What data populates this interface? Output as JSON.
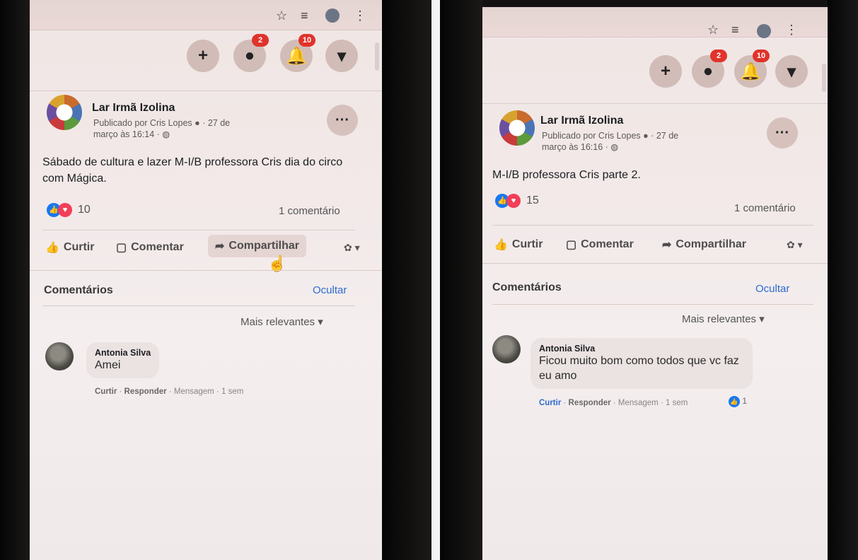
{
  "screenshots": [
    {
      "browser": {
        "star_icon": "star-icon",
        "queue_icon": "reading-list-icon",
        "menu_icon": "more-vert-icon"
      },
      "header": {
        "create_label": "+",
        "messenger_badge": "2",
        "notifications_badge": "10"
      },
      "post": {
        "page_name": "Lar Irmã Izolina",
        "meta_line1": "Publicado por Cris Lopes",
        "meta_date": "· 27 de",
        "meta_line2": "março às 16:14 ·",
        "text": "Sábado de cultura e lazer M-I/B professora Cris dia do circo com Mágica.",
        "reaction_count": "10",
        "comment_count": "1 comentário"
      },
      "actions": {
        "like": "Curtir",
        "comment": "Comentar",
        "share": "Compartilhar"
      },
      "comments": {
        "title": "Comentários",
        "hide": "Ocultar",
        "sort": "Mais relevantes ▾",
        "items": [
          {
            "author": "Antonia Silva",
            "text": "Amei",
            "like": "Curtir",
            "reply": "Responder",
            "message": "Mensagem",
            "time": "1 sem"
          }
        ]
      }
    },
    {
      "browser": {
        "star_icon": "star-icon",
        "queue_icon": "reading-list-icon",
        "menu_icon": "more-vert-icon"
      },
      "header": {
        "create_label": "+",
        "messenger_badge": "2",
        "notifications_badge": "10"
      },
      "post": {
        "page_name": "Lar Irmã Izolina",
        "meta_line1": "Publicado por Cris Lopes",
        "meta_date": "· 27 de",
        "meta_line2": "março às 16:16 ·",
        "text": "M-I/B professora Cris parte 2.",
        "reaction_count": "15",
        "comment_count": "1 comentário"
      },
      "actions": {
        "like": "Curtir",
        "comment": "Comentar",
        "share": "Compartilhar"
      },
      "comments": {
        "title": "Comentários",
        "hide": "Ocultar",
        "sort": "Mais relevantes ▾",
        "items": [
          {
            "author": "Antonia Silva",
            "text": "Ficou muito bom como todos que vc faz eu amo",
            "like": "Curtir",
            "reply": "Responder",
            "message": "Mensagem",
            "time": "1 sem",
            "reaction_count": "1"
          }
        ]
      }
    }
  ]
}
